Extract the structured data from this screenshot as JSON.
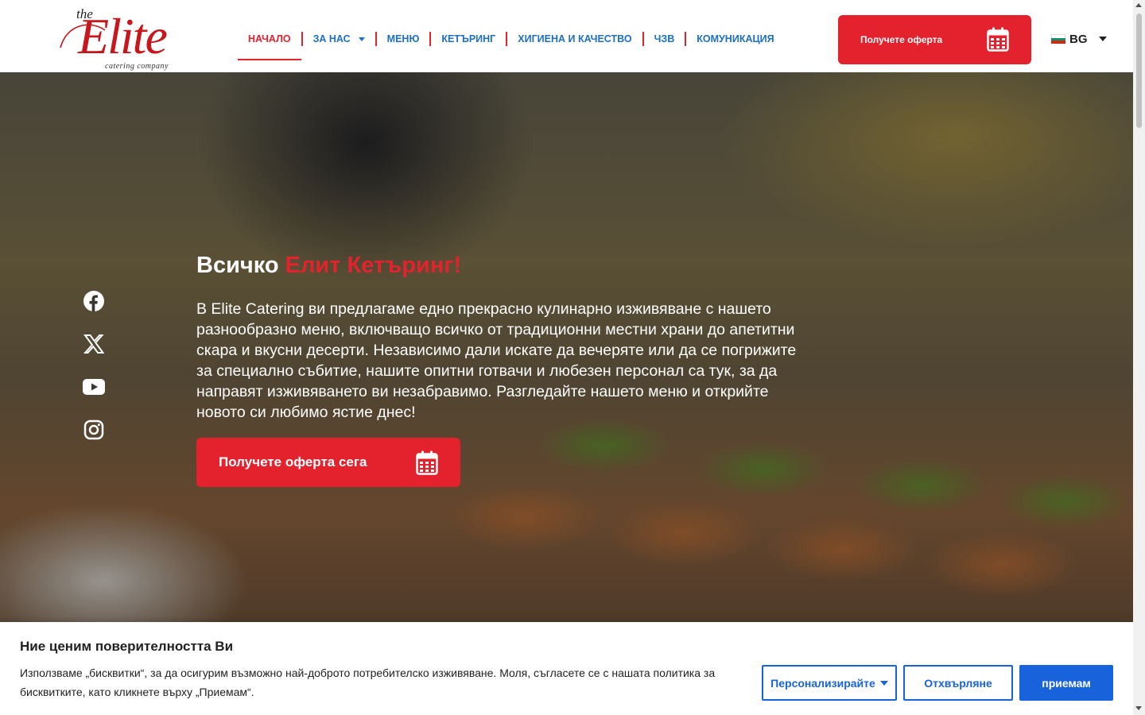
{
  "brand": {
    "logo_the": "the",
    "logo_name": "Elite",
    "logo_tagline": "catering company",
    "accent_color": "#e3222d",
    "link_color": "#1d6fc4"
  },
  "nav": {
    "items": [
      {
        "label": "НАЧАЛО",
        "active": true
      },
      {
        "label": "ЗА НАС",
        "has_dropdown": true
      },
      {
        "label": "МЕНЮ"
      },
      {
        "label": "КЕТЪРИНГ"
      },
      {
        "label": "ХИГИЕНА И КАЧЕСТВО"
      },
      {
        "label": "ЧЗВ"
      },
      {
        "label": "КОМУНИКАЦИЯ"
      }
    ]
  },
  "header": {
    "quote_button": "Получете оферта",
    "quote_icon": "calendar-icon",
    "language": "BG",
    "flag_icon": "bulgaria-flag-icon"
  },
  "hero": {
    "title_prefix": "Всичко",
    "title_accent": "Елит Кетъринг!",
    "text": "В Elite Catering ви предлагаме едно прекрасно кулинарно изживяване с нашето разнообразно меню, включващо всичко от традиционни местни храни до апетитни скара и вкусни десерти. Независимо дали искате да вечеряте или да се погрижите за специално събитие, нашите опитни готвачи и любезен персонал са тук, за да направят изживяването ви незабравимо. Разгледайте нашето меню и открийте новото си любимо ястие днес!",
    "cta_button": "Получете оферта сега",
    "cta_icon": "calendar-icon",
    "social": [
      "facebook-icon",
      "x-icon",
      "youtube-icon",
      "instagram-icon"
    ]
  },
  "cookie": {
    "title": "Ние ценим поверителността Ви",
    "text": "Използваме „бисквитки“, за да осигурим възможно най-доброто потребителско изживяване. Моля, съгласете се с нашата политика за бисквитките, като кликнете върху „Приемам“.",
    "customize_button": "Персонализирайте",
    "reject_button": "Отхвърляне",
    "accept_button": "приемам",
    "button_color": "#1863dc"
  }
}
